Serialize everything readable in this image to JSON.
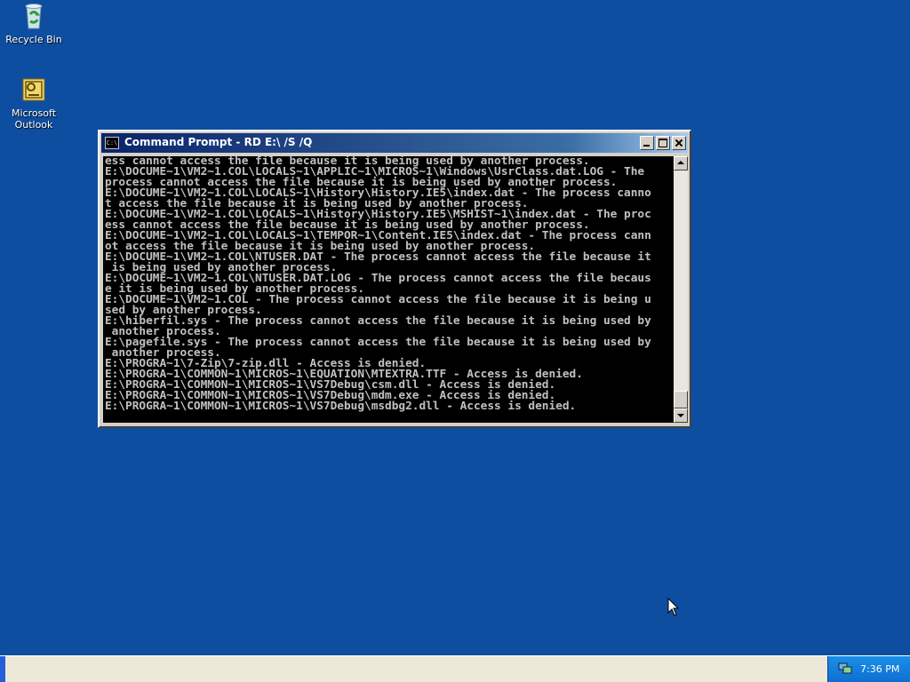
{
  "desktop": {
    "icons": [
      {
        "label": "Recycle Bin"
      },
      {
        "label": "Microsoft Outlook"
      }
    ]
  },
  "window": {
    "title": "Command Prompt - RD E:\\ /S /Q",
    "icon_text": "C:\\",
    "lines": [
      "ess cannot access the file because it is being used by another process.",
      "E:\\DOCUME~1\\VM2~1.COL\\LOCALS~1\\APPLIC~1\\MICROS~1\\Windows\\UsrClass.dat.LOG - The",
      "process cannot access the file because it is being used by another process.",
      "E:\\DOCUME~1\\VM2~1.COL\\LOCALS~1\\History\\History.IE5\\index.dat - The process canno",
      "t access the file because it is being used by another process.",
      "E:\\DOCUME~1\\VM2~1.COL\\LOCALS~1\\History\\History.IE5\\MSHIST~1\\index.dat - The proc",
      "ess cannot access the file because it is being used by another process.",
      "E:\\DOCUME~1\\VM2~1.COL\\LOCALS~1\\TEMPOR~1\\Content.IE5\\index.dat - The process cann",
      "ot access the file because it is being used by another process.",
      "E:\\DOCUME~1\\VM2~1.COL\\NTUSER.DAT - The process cannot access the file because it",
      " is being used by another process.",
      "E:\\DOCUME~1\\VM2~1.COL\\NTUSER.DAT.LOG - The process cannot access the file becaus",
      "e it is being used by another process.",
      "E:\\DOCUME~1\\VM2~1.COL - The process cannot access the file because it is being u",
      "sed by another process.",
      "E:\\hiberfil.sys - The process cannot access the file because it is being used by",
      " another process.",
      "E:\\pagefile.sys - The process cannot access the file because it is being used by",
      " another process.",
      "E:\\PROGRA~1\\7-Zip\\7-zip.dll - Access is denied.",
      "E:\\PROGRA~1\\COMMON~1\\MICROS~1\\EQUATION\\MTEXTRA.TTF - Access is denied.",
      "E:\\PROGRA~1\\COMMON~1\\MICROS~1\\VS7Debug\\csm.dll - Access is denied.",
      "E:\\PROGRA~1\\COMMON~1\\MICROS~1\\VS7Debug\\mdm.exe - Access is denied.",
      "E:\\PROGRA~1\\COMMON~1\\MICROS~1\\VS7Debug\\msdbg2.dll - Access is denied."
    ]
  },
  "taskbar": {
    "clock": "7:36 PM"
  },
  "colors": {
    "desktop": "#0d4ea0",
    "console_bg": "#000000",
    "console_fg": "#c0c0c0",
    "taskbar": "#ece9d8",
    "tray": "#1a8fe8"
  }
}
